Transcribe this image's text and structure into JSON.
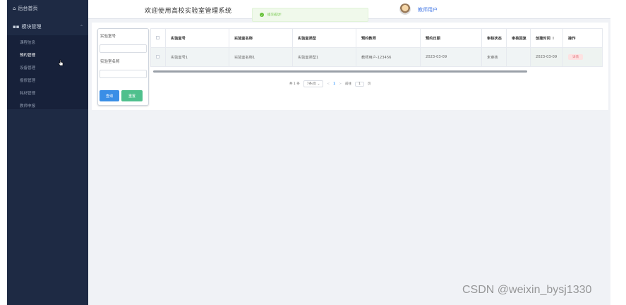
{
  "sidebar": {
    "home_label": "后台首页",
    "module_label": "模块管理",
    "items": [
      {
        "label": "课程信息"
      },
      {
        "label": "预约管理"
      },
      {
        "label": "设备管理"
      },
      {
        "label": "报修管理"
      },
      {
        "label": "耗材管理"
      },
      {
        "label": "教师申报"
      }
    ]
  },
  "header": {
    "title": "欢迎使用高校实验室管理系统",
    "toast": "提交成功!",
    "user": "教师用户"
  },
  "search": {
    "field1_label": "实验室号",
    "field2_label": "实验室名称",
    "query_button": "查询",
    "reset_button": "重置"
  },
  "table": {
    "headers": [
      "实验室号",
      "实验室名称",
      "实验室类型",
      "预约教师",
      "预约日期",
      "审核状态",
      "审核回复",
      "创建时间",
      "操作"
    ],
    "rows": [
      {
        "lab_no": "实验室号1",
        "lab_name": "实验室名称1",
        "lab_type": "实验室类型1",
        "teacher": "教师用户-123456",
        "date": "2023-03-09",
        "status": "未审核",
        "reply": "",
        "created": "2023-03-09",
        "action": "详情"
      }
    ]
  },
  "pagination": {
    "total": "共 1 条",
    "page_size": "7条/页",
    "prev": "<",
    "current": "1",
    "next": ">",
    "goto_label": "前往",
    "goto_value": "1",
    "goto_suffix": "页"
  },
  "watermark": "CSDN @weixin_bysj1330",
  "colors": {
    "sidebar_bg": "#1e2a44",
    "primary": "#3a8ee6",
    "success": "#4fc08d",
    "toast_green": "#67c23a",
    "user_blue": "#4a7ce6"
  }
}
